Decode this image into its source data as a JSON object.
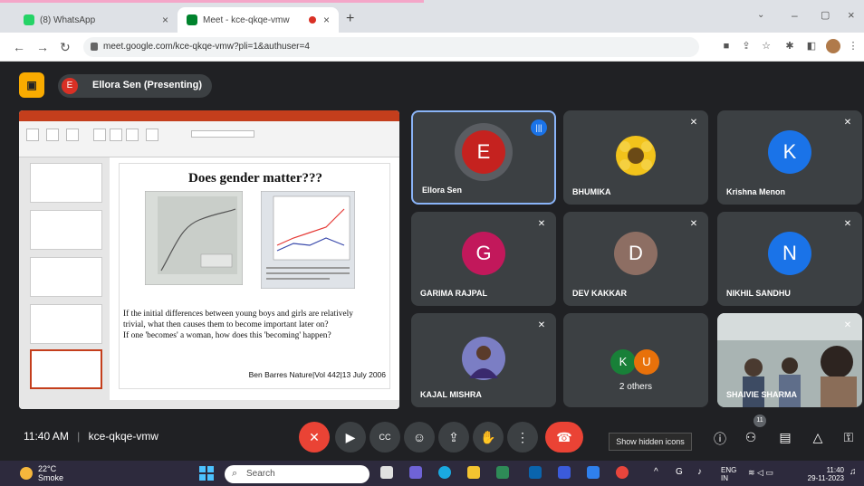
{
  "browser": {
    "tabs": [
      {
        "label": "(8) WhatsApp",
        "color": "#25d366"
      },
      {
        "label": "Meet - kce-qkqe-vmw",
        "color": "#00832d"
      }
    ],
    "url": "meet.google.com/kce-qkqe-vmw?pli=1&authuser=4"
  },
  "meet": {
    "presenting_label": "Ellora Sen (Presenting)",
    "presenter_initial": "E",
    "time": "11:40 AM",
    "separator": "|",
    "meeting_code": "kce-qkqe-vmw",
    "tooltip": "Show hidden icons",
    "people_count": "11"
  },
  "slide": {
    "title": "Does gender matter???",
    "body_lines": [
      "If the initial differences between young boys and girls are relatively",
      "trivial, what then causes them to become important later on?",
      "If one 'becomes' a woman, how does this 'becoming' happen?"
    ],
    "citation": "Ben Barres Nature|Vol 442|13 July 2006"
  },
  "tiles": [
    {
      "name": "Ellora Sen",
      "initial": "E",
      "color": "#c5221f",
      "speaking": true
    },
    {
      "name": "BHUMIKA",
      "image": "sunflower-image"
    },
    {
      "name": "Krishna Menon",
      "initial": "K",
      "color": "#1a73e8"
    },
    {
      "name": "GARIMA RAJPAL",
      "initial": "G",
      "color": "#c2185b"
    },
    {
      "name": "DEV KAKKAR",
      "initial": "D",
      "color": "#8d6e63"
    },
    {
      "name": "NIKHIL SANDHU",
      "initial": "N",
      "color": "#1a73e8"
    },
    {
      "name": "KAJAL MISHRA",
      "image": "profile-photo"
    },
    {
      "label": "2 others",
      "initials": [
        "K",
        "U"
      ],
      "colors": [
        "#188038",
        "#e8710a"
      ]
    },
    {
      "name": "SHAIVIE SHARMA",
      "image": "video-feed"
    }
  ],
  "taskbar": {
    "temp": "22°C",
    "weather": "Smoke",
    "search_placeholder": "Search",
    "lang": "ENG",
    "region": "IN",
    "clock_time": "11:40",
    "clock_date": "29-11-2023"
  }
}
